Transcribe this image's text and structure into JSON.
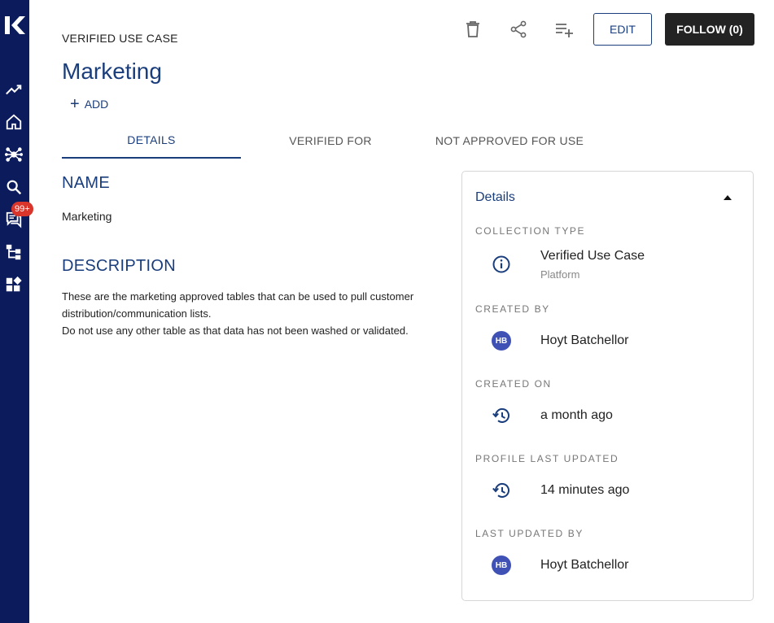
{
  "sidebar": {
    "items": [
      {
        "icon": "trending-icon"
      },
      {
        "icon": "home-icon"
      },
      {
        "icon": "network-icon"
      },
      {
        "icon": "search-icon"
      },
      {
        "icon": "chat-icon",
        "badge": "99+"
      },
      {
        "icon": "hierarchy-icon"
      },
      {
        "icon": "widgets-icon"
      }
    ]
  },
  "header": {
    "eyebrow": "VERIFIED USE CASE",
    "title": "Marketing",
    "add_label": "ADD",
    "edit_label": "EDIT",
    "follow_label": "FOLLOW (0)"
  },
  "tabs": [
    {
      "label": "DETAILS",
      "active": true
    },
    {
      "label": "VERIFIED FOR",
      "active": false
    },
    {
      "label": "NOT APPROVED FOR USE",
      "active": false
    }
  ],
  "main": {
    "name_heading": "NAME",
    "name_value": "Marketing",
    "description_heading": "DESCRIPTION",
    "description_lines": [
      "These are the marketing approved tables that can be used to pull customer",
      "distribution/communication lists.",
      "Do not use any other table as that data has not been washed or validated."
    ]
  },
  "panel": {
    "title": "Details",
    "collection_type_label": "COLLECTION TYPE",
    "collection_type_value": "Verified Use Case",
    "collection_type_sub": "Platform",
    "created_by_label": "CREATED BY",
    "created_by_initials": "HB",
    "created_by_value": "Hoyt Batchellor",
    "created_on_label": "CREATED ON",
    "created_on_value": "a month ago",
    "profile_updated_label": "PROFILE LAST UPDATED",
    "profile_updated_value": "14 minutes ago",
    "last_updated_by_label": "LAST UPDATED BY",
    "last_updated_by_initials": "HB",
    "last_updated_by_value": "Hoyt Batchellor"
  },
  "colors": {
    "sidebar": "#0b1b5c",
    "accent": "#1a3d7c",
    "badge": "#d9352b",
    "avatar": "#3f51b5",
    "follow_button": "#232323"
  }
}
